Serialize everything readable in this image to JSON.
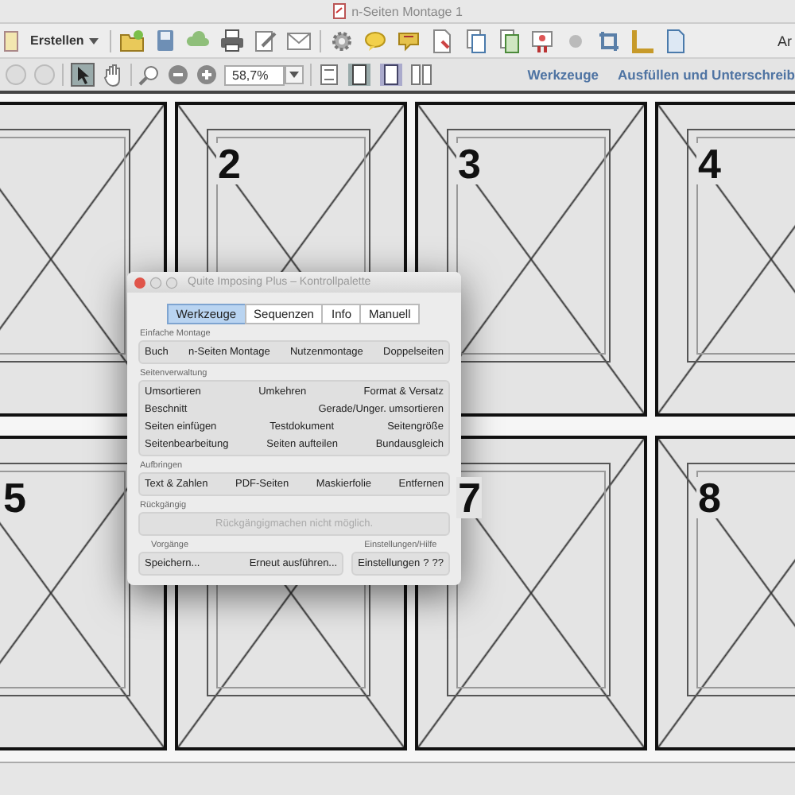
{
  "window": {
    "title": "n-Seiten Montage 1"
  },
  "toolbar": {
    "create_button": "Erstellen",
    "cut_label": "Ar"
  },
  "nav_bar": {
    "zoom": "58,7%",
    "links": [
      "Werkzeuge",
      "Ausfüllen und Unterschreib"
    ]
  },
  "pages": [
    {
      "kind": "plain"
    },
    {
      "kind": "numbered",
      "number": "2"
    },
    {
      "kind": "numbered",
      "number": "3"
    },
    {
      "kind": "numbered",
      "number": "4"
    },
    {
      "kind": "numbered",
      "number": "5"
    },
    {
      "kind": "plain"
    },
    {
      "kind": "numbered",
      "number": "7"
    },
    {
      "kind": "numbered",
      "number": "8"
    }
  ],
  "palette": {
    "title": "Quite Imposing Plus – Kontrollpalette",
    "tabs": [
      {
        "label": "Werkzeuge",
        "selected": true
      },
      {
        "label": "Sequenzen",
        "selected": false
      },
      {
        "label": "Info",
        "selected": false
      },
      {
        "label": "Manuell",
        "selected": false
      }
    ],
    "sections": [
      {
        "title": "Einfache Montage",
        "disabled": false,
        "rows": [
          [
            "Buch",
            "n-Seiten Montage",
            "Nutzenmontage",
            "Doppelseiten"
          ]
        ]
      },
      {
        "title": "Seitenverwaltung",
        "disabled": false,
        "rows": [
          [
            "Umsortieren",
            "Umkehren",
            "Format & Versatz"
          ],
          [
            "Beschnitt",
            "Gerade/Unger. umsortieren"
          ],
          [
            "Seiten einfügen",
            "Testdokument",
            "Seitengröße"
          ],
          [
            "Seitenbearbeitung",
            "Seiten aufteilen",
            "Bundausgleich"
          ]
        ]
      },
      {
        "title": "Aufbringen",
        "disabled": false,
        "rows": [
          [
            "Text & Zahlen",
            "PDF-Seiten",
            "Maskierfolie",
            "Entfernen"
          ]
        ]
      },
      {
        "title": "Rückgängig",
        "disabled": true,
        "rows": [
          [
            "Rückgängigmachen nicht möglich."
          ]
        ]
      }
    ],
    "groups": [
      {
        "title": "Vorgänge",
        "buttons": [
          "Speichern...",
          "Erneut ausführen..."
        ]
      },
      {
        "title": "Einstellungen/Hilfe",
        "buttons": [
          "Einstellungen",
          "?",
          "??"
        ]
      }
    ]
  }
}
